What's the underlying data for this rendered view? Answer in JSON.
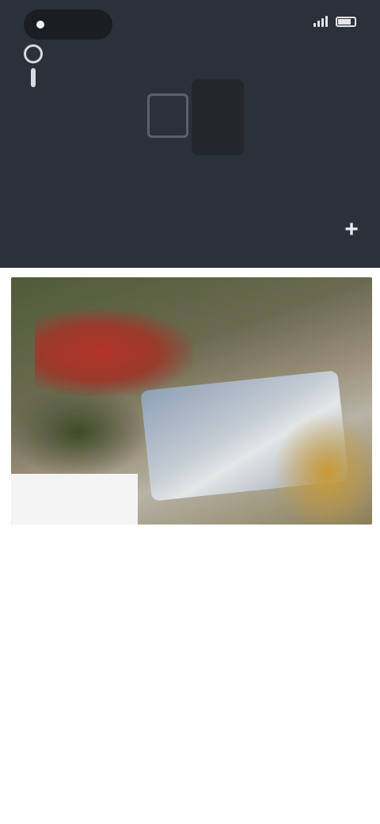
{
  "status_bar": {
    "time": "",
    "network": "",
    "sub": ""
  },
  "header": {
    "title": "",
    "action_icon": "plus-icon",
    "side_icon": "pin-icon"
  },
  "content": {
    "headline": "",
    "body": ""
  },
  "colors": {
    "header_bg": "#2b313a",
    "page_bg": "#ffffff"
  }
}
